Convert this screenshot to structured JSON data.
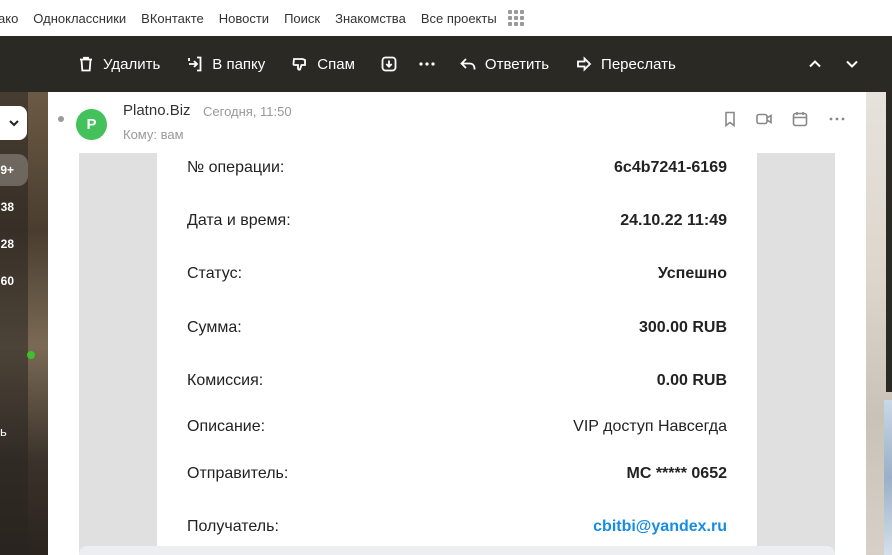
{
  "topnav": {
    "links": [
      "ако",
      "Одноклассники",
      "ВКонтакте",
      "Новости",
      "Поиск",
      "Знакомства",
      "Все проекты"
    ]
  },
  "toolbar": {
    "delete_label": "Удалить",
    "move_label": "В папку",
    "spam_label": "Спам",
    "reply_label": "Ответить",
    "forward_label": "Переслать"
  },
  "sidebar": {
    "counters": [
      "9+",
      "38",
      "28",
      "60"
    ],
    "label": "ь"
  },
  "message": {
    "avatar_letter": "P",
    "sender": "Platno.Biz",
    "date": "Сегодня, 11:50",
    "to": "Кому: вам",
    "avatar_color": "#43c15a",
    "accent_link": "#168de2"
  },
  "receipt": {
    "rows": [
      {
        "label": "№ операции:",
        "value": "6c4b7241-6169"
      },
      {
        "label": "Дата и время:",
        "value": "24.10.22 11:49"
      },
      {
        "label": "Статус:",
        "value": "Успешно"
      },
      {
        "label": "Сумма:",
        "value": "300.00 RUB"
      },
      {
        "label": "Комиссия:",
        "value": "0.00 RUB"
      },
      {
        "label": "Описание:",
        "value": "VIP доступ Навсегда"
      },
      {
        "label": "Отправитель:",
        "value": "MC ***** 0652"
      },
      {
        "label": "Получатель:",
        "value": "cbitbi@yandex.ru"
      }
    ]
  }
}
